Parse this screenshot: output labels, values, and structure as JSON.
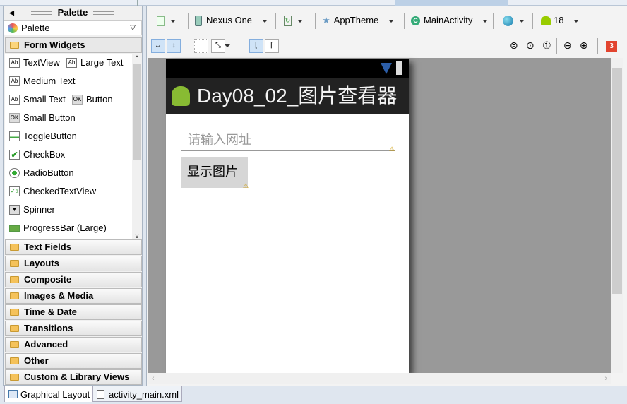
{
  "palette": {
    "header": "Palette",
    "dropdown_label": "Palette",
    "open_category": "Form Widgets",
    "widgets": [
      {
        "label": "TextView",
        "icon": "Ab"
      },
      {
        "label": "Large Text",
        "icon": "Ab"
      },
      {
        "label": "Medium Text",
        "icon": "Ab"
      },
      {
        "label": "Small Text",
        "icon": "Ab"
      },
      {
        "label": "Button",
        "icon": "OK"
      },
      {
        "label": "Small Button",
        "icon": "OK"
      },
      {
        "label": "ToggleButton",
        "icon": "toggle-icon"
      },
      {
        "label": "CheckBox",
        "icon": "checkbox-icon"
      },
      {
        "label": "RadioButton",
        "icon": "radio-icon"
      },
      {
        "label": "CheckedTextView",
        "icon": "checked-text-icon"
      },
      {
        "label": "Spinner",
        "icon": "spinner-icon"
      },
      {
        "label": "ProgressBar (Large)",
        "icon": "progress-icon"
      }
    ],
    "categories": [
      "Text Fields",
      "Layouts",
      "Composite",
      "Images & Media",
      "Time & Date",
      "Transitions",
      "Advanced",
      "Other",
      "Custom & Library Views"
    ]
  },
  "toolbar": {
    "device": "Nexus One",
    "theme": "AppTheme",
    "activity": "MainActivity",
    "api_level": "18",
    "error_count": "3"
  },
  "preview": {
    "app_title": "Day08_02_图片查看器",
    "edittext_hint": "请输入网址",
    "button_label": "显示图片"
  },
  "bottom_tabs": [
    "Graphical Layout",
    "activity_main.xml"
  ],
  "colors": {
    "accent": "#84aede",
    "error": "#e2442f",
    "android_green": "#9c0"
  }
}
